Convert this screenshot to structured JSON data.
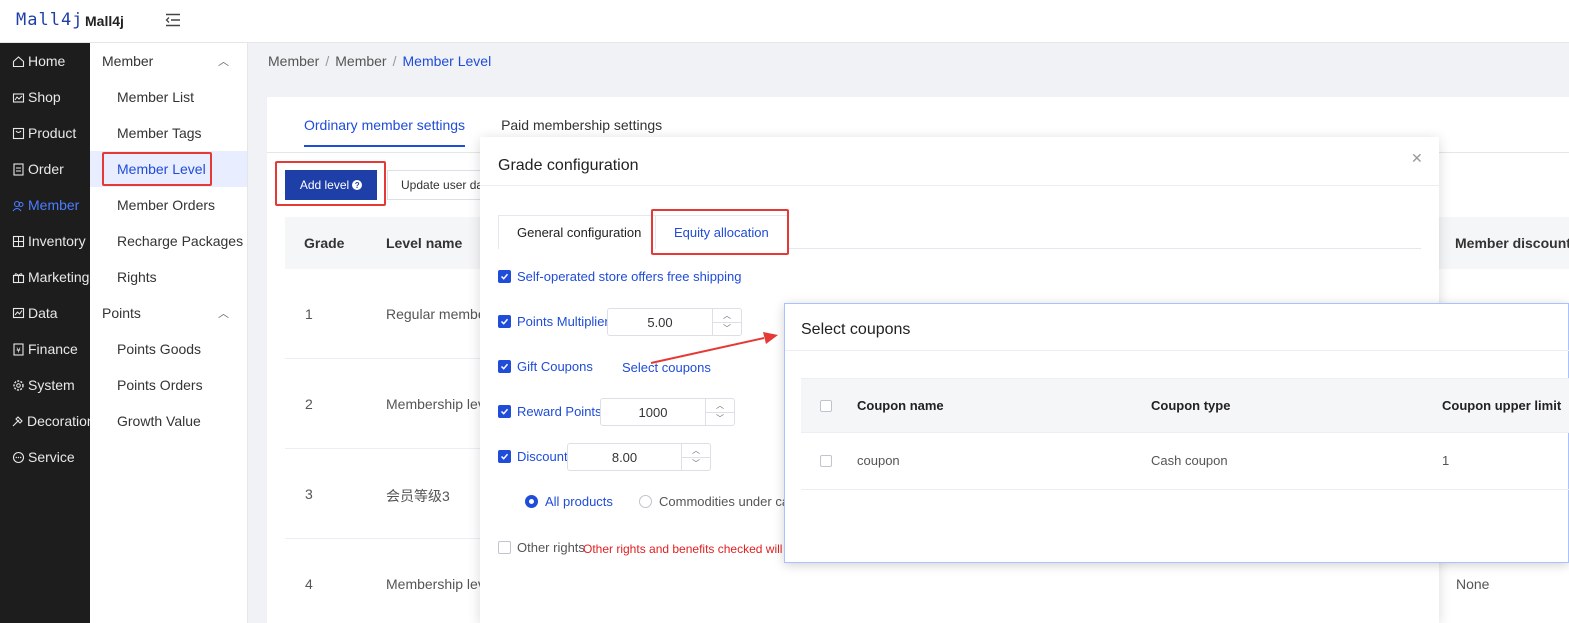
{
  "header": {
    "logo": "Mall4j",
    "app_name": "Mall4j"
  },
  "nav": [
    {
      "label": "Home",
      "icon": "home-icon"
    },
    {
      "label": "Shop",
      "icon": "shop-icon"
    },
    {
      "label": "Product",
      "icon": "product-icon"
    },
    {
      "label": "Order",
      "icon": "order-icon"
    },
    {
      "label": "Member",
      "icon": "member-icon",
      "active": true
    },
    {
      "label": "Inventory",
      "icon": "inventory-icon"
    },
    {
      "label": "Marketing",
      "icon": "gift-icon"
    },
    {
      "label": "Data",
      "icon": "data-icon"
    },
    {
      "label": "Finance",
      "icon": "finance-icon"
    },
    {
      "label": "System",
      "icon": "gear-icon"
    },
    {
      "label": "Decoration",
      "icon": "decoration-icon"
    },
    {
      "label": "Service",
      "icon": "chat-icon"
    }
  ],
  "subnav": {
    "member_group": "Member",
    "member_items": [
      "Member List",
      "Member Tags",
      "Member Level",
      "Member Orders",
      "Recharge Packages",
      "Rights"
    ],
    "points_group": "Points",
    "points_items": [
      "Points Goods",
      "Points Orders",
      "Growth Value"
    ]
  },
  "breadcrumb": [
    "Member",
    "Member",
    "Member Level"
  ],
  "page": {
    "tabs": [
      "Ordinary member settings",
      "Paid membership settings"
    ],
    "add_level": "Add level",
    "update_user": "Update user data",
    "table": {
      "headers": {
        "grade": "Grade",
        "level_name": "Level name",
        "member_discount": "Member discount"
      },
      "rows": [
        {
          "grade": "1",
          "name": "Regular member",
          "discount": ""
        },
        {
          "grade": "2",
          "name": "Membership level",
          "discount": ""
        },
        {
          "grade": "3",
          "name": "会员等级3",
          "discount": ""
        },
        {
          "grade": "4",
          "name": "Membership level",
          "discount": "None"
        }
      ]
    }
  },
  "dialog": {
    "title": "Grade configuration",
    "tabs": [
      "General configuration",
      "Equity allocation"
    ],
    "free_shipping": "Self-operated store offers free shipping",
    "points_multiplier": {
      "label": "Points Multiplier",
      "value": "5.00"
    },
    "gift_coupons": {
      "label": "Gift Coupons",
      "link": "Select coupons"
    },
    "reward_points": {
      "label": "Reward Points",
      "value": "1000"
    },
    "discount": {
      "label": "Discount",
      "value": "8.00"
    },
    "scope": {
      "all": "All products",
      "category": "Commodities under category"
    },
    "other_rights": {
      "label": "Other rights",
      "warning": "Other rights and benefits checked will be displayed"
    }
  },
  "coupons": {
    "title": "Select coupons",
    "headers": [
      "Coupon name",
      "Coupon type",
      "Coupon upper limit"
    ],
    "rows": [
      {
        "name": "coupon",
        "type": "Cash coupon",
        "limit": "1"
      }
    ]
  },
  "colors": {
    "accent": "#1f4cd9",
    "highlight": "#e53935",
    "nav_bg": "#1d1d1d"
  }
}
